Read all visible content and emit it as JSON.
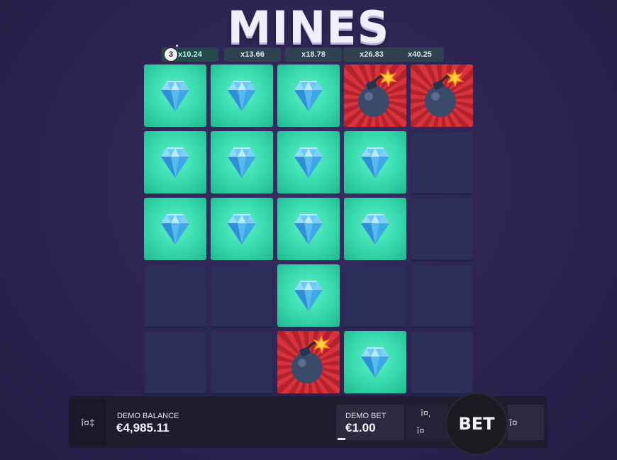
{
  "title": "MINES",
  "mines_count": "3",
  "multipliers": [
    "x10.24",
    "x13.66",
    "x18.78",
    "x26.83",
    "x40.25"
  ],
  "grid": {
    "rows": [
      [
        "gem",
        "gem",
        "gem",
        "bomb",
        "bomb"
      ],
      [
        "gem",
        "gem",
        "gem",
        "gem",
        "hidden"
      ],
      [
        "gem",
        "gem",
        "gem",
        "gem",
        "hidden"
      ],
      [
        "hidden",
        "hidden",
        "gem",
        "hidden",
        "hidden"
      ],
      [
        "hidden",
        "hidden",
        "bomb",
        "gem",
        "hidden"
      ]
    ]
  },
  "colors": {
    "gem_tile": "#36d8ad",
    "bomb_tile": "#d8333c",
    "hidden_tile": "#2b2f5a",
    "background": "#2c2350"
  },
  "bottom_bar": {
    "menu_icon_text": "î¤‡",
    "balance_label": "DEMO BALANCE",
    "balance_value": "€4,985.11",
    "bet_label": "DEMO BET",
    "bet_value": "€1.00",
    "increase_icon_text": "î¤‚",
    "decrease_icon_text": "î¤",
    "bet_button_label": "BET",
    "auto_icon_text": "î¤"
  }
}
